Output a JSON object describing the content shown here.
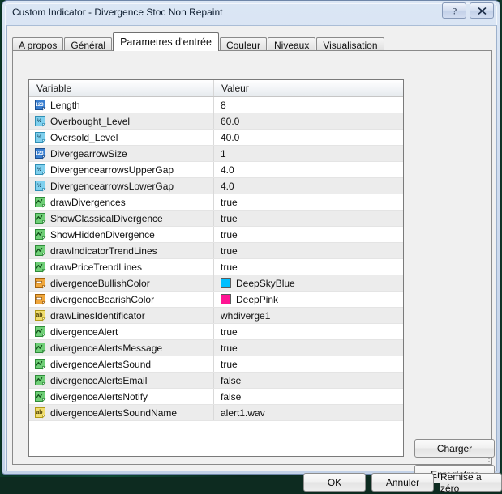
{
  "window": {
    "title": "Custom Indicator - Divergence Stoc Non Repaint",
    "help_label": "?",
    "close_label": "X"
  },
  "tabs": [
    {
      "label": "A propos",
      "active": false
    },
    {
      "label": "Général",
      "active": false
    },
    {
      "label": "Parametres d'entrée",
      "active": true
    },
    {
      "label": "Couleur",
      "active": false
    },
    {
      "label": "Niveaux",
      "active": false
    },
    {
      "label": "Visualisation",
      "active": false
    }
  ],
  "table": {
    "columns": [
      "Variable",
      "Valeur"
    ],
    "rows": [
      {
        "icon": "int-icon",
        "name": "Length",
        "value": "8"
      },
      {
        "icon": "double-icon",
        "name": "Overbought_Level",
        "value": "60.0"
      },
      {
        "icon": "double-icon",
        "name": "Oversold_Level",
        "value": "40.0"
      },
      {
        "icon": "int-icon",
        "name": "DivergearrowSize",
        "value": "1"
      },
      {
        "icon": "double-icon",
        "name": "DivergencearrowsUpperGap",
        "value": "4.0"
      },
      {
        "icon": "double-icon",
        "name": "DivergencearrowsLowerGap",
        "value": "4.0"
      },
      {
        "icon": "bool-icon",
        "name": "drawDivergences",
        "value": "true"
      },
      {
        "icon": "bool-icon",
        "name": "ShowClassicalDivergence",
        "value": "true"
      },
      {
        "icon": "bool-icon",
        "name": "ShowHiddenDivergence",
        "value": "true"
      },
      {
        "icon": "bool-icon",
        "name": "drawIndicatorTrendLines",
        "value": "true"
      },
      {
        "icon": "bool-icon",
        "name": "drawPriceTrendLines",
        "value": "true"
      },
      {
        "icon": "color-icon",
        "name": "divergenceBullishColor",
        "value": "DeepSkyBlue",
        "swatch": "#00BFFF"
      },
      {
        "icon": "color-icon",
        "name": "divergenceBearishColor",
        "value": "DeepPink",
        "swatch": "#FF1493"
      },
      {
        "icon": "string-icon",
        "name": "drawLinesIdentificator",
        "value": "whdiverge1"
      },
      {
        "icon": "bool-icon",
        "name": "divergenceAlert",
        "value": "true"
      },
      {
        "icon": "bool-icon",
        "name": "divergenceAlertsMessage",
        "value": "true"
      },
      {
        "icon": "bool-icon",
        "name": "divergenceAlertsSound",
        "value": "true"
      },
      {
        "icon": "bool-icon",
        "name": "divergenceAlertsEmail",
        "value": "false"
      },
      {
        "icon": "bool-icon",
        "name": "divergenceAlertsNotify",
        "value": "false"
      },
      {
        "icon": "string-icon",
        "name": "divergenceAlertsSoundName",
        "value": "alert1.wav"
      }
    ]
  },
  "side_buttons": {
    "load": "Charger",
    "save": "Enregistrer"
  },
  "bottom_buttons": {
    "ok": "OK",
    "cancel": "Annuler",
    "reset": "Remise a zéro"
  },
  "colors": {
    "deep_sky_blue": "#00BFFF",
    "deep_pink": "#FF1493",
    "int_icon": "#2f6cbf",
    "double_icon": "#6fc7ea",
    "bool_icon": "#3fa94b",
    "color_icon": "#e08a18",
    "string_icon": "#e8c84a"
  }
}
